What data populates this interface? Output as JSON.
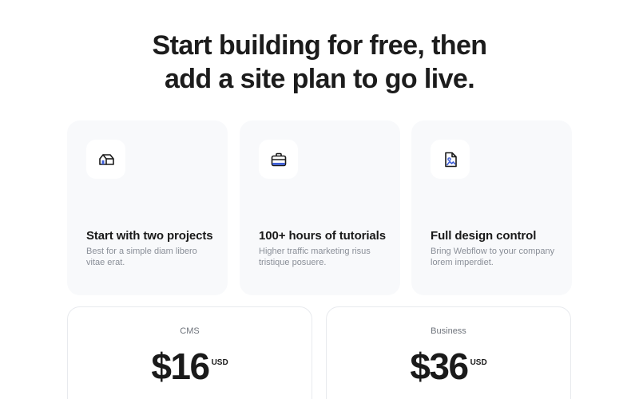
{
  "hero": {
    "title_line1": "Start building for free, then",
    "title_line2": "add a site plan to go live."
  },
  "features": [
    {
      "icon": "house-tag-icon",
      "title": "Start with two projects",
      "description": "Best for a simple diam libero vitae erat."
    },
    {
      "icon": "briefcase-icon",
      "title": "100+ hours of tutorials",
      "description": "Higher traffic marketing risus tristique posuere."
    },
    {
      "icon": "image-file-icon",
      "title": "Full design control",
      "description": "Bring Webflow to your company lorem imperdiet."
    }
  ],
  "plans": [
    {
      "name": "CMS",
      "price": "$16",
      "currency": "USD"
    },
    {
      "name": "Business",
      "price": "$36",
      "currency": "USD"
    }
  ],
  "colors": {
    "card_background": "#f8f9fb",
    "text_primary": "#1a1a1a",
    "text_muted": "#8a8f98",
    "icon_accent": "#3f5fd8"
  }
}
